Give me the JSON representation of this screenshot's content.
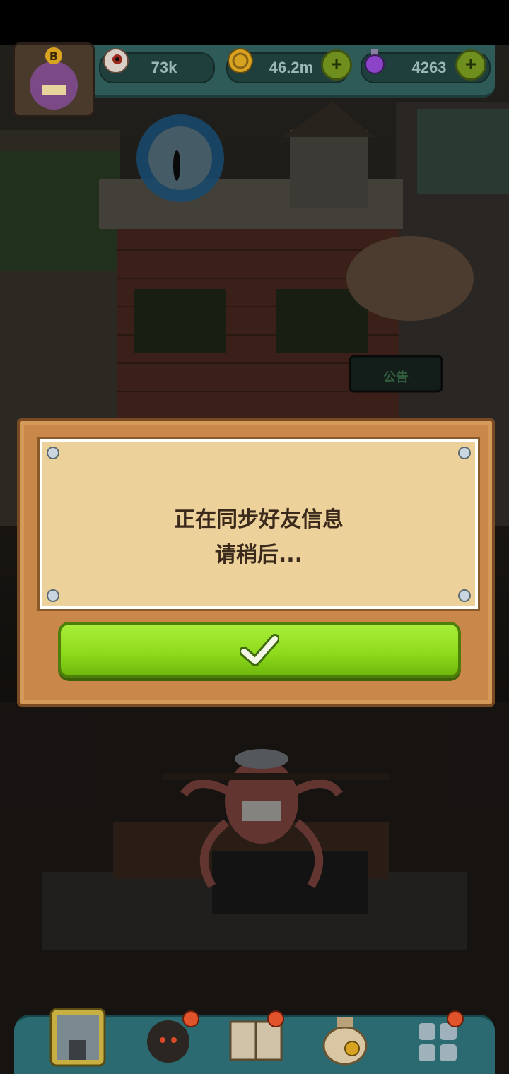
{
  "hud": {
    "eyes": {
      "icon": "eyeball-icon",
      "value": "73k"
    },
    "coins": {
      "icon": "coin-icon",
      "value": "46.2m"
    },
    "potions": {
      "icon": "potion-icon",
      "value": "4263"
    },
    "avatar_badge": "B"
  },
  "scene": {
    "notice_board_label": "公告"
  },
  "dialog": {
    "line1": "正在同步好友信息",
    "line2": "请稍后...",
    "confirm_icon": "checkmark-icon"
  },
  "bottom_nav": [
    {
      "name": "building",
      "icon": "building-icon"
    },
    {
      "name": "monsters",
      "icon": "monster-icon"
    },
    {
      "name": "recipe-book",
      "icon": "book-icon"
    },
    {
      "name": "money-bag",
      "icon": "money-bag-icon"
    },
    {
      "name": "menu-grid",
      "icon": "grid-icon"
    }
  ],
  "colors": {
    "accent_green": "#8fdb1c",
    "dialog_wood": "#c9884a",
    "paper": "#edd19a",
    "hud_teal": "#2e5a57"
  }
}
